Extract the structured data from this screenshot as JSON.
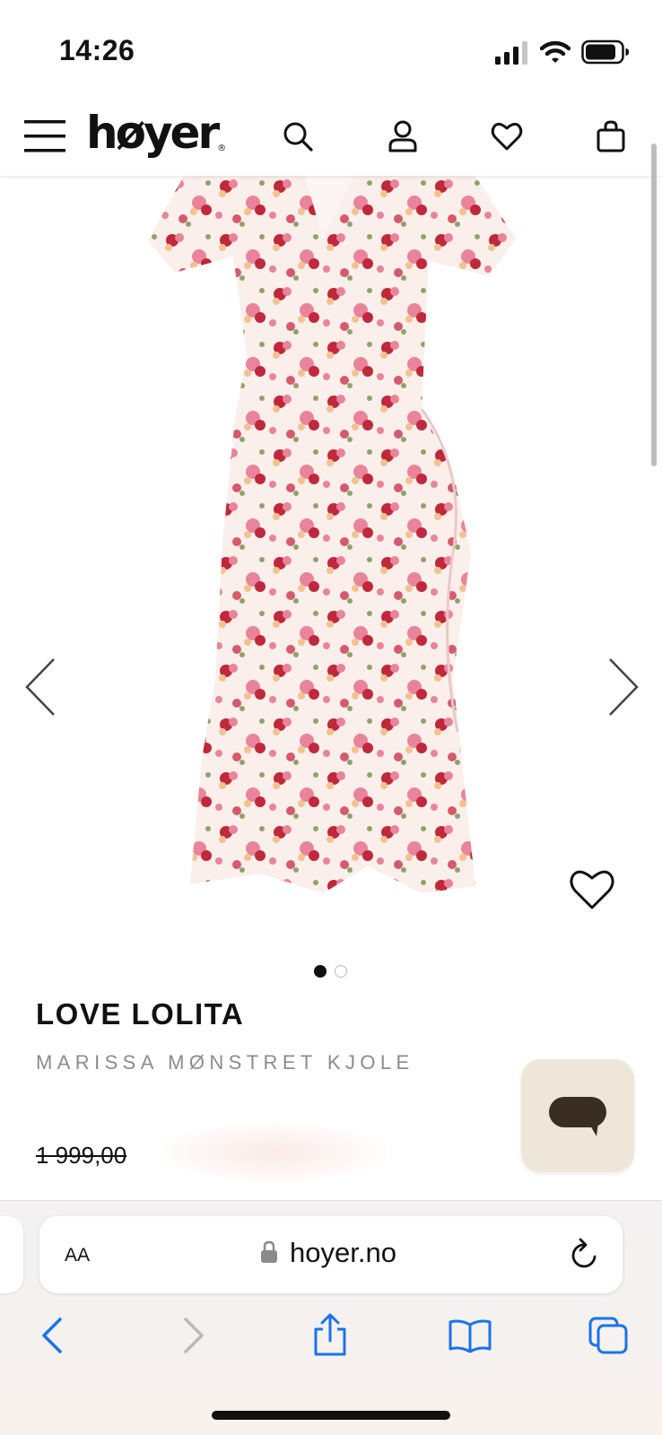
{
  "status_bar": {
    "time": "14:26",
    "icons": [
      "cellular-signal-icon",
      "wifi-icon",
      "battery-icon"
    ]
  },
  "header": {
    "logo": "høyer",
    "logo_mark": "®",
    "icons": [
      "menu-icon",
      "search-icon",
      "user-icon",
      "heart-icon",
      "shopping-bag-icon"
    ]
  },
  "product": {
    "brand": "LOVE LOLITA",
    "name": "MARISSA MØNSTRET KJOLE",
    "price_original": "1 999,00",
    "image_count": 2,
    "active_image": 1,
    "colors": {
      "dress_base": "#fbefec",
      "flower_red": "#c0283b",
      "flower_pink": "#e9849a",
      "flower_peach": "#f2c38f"
    }
  },
  "chat": {
    "background": "#efe6da",
    "icon": "chat-bubble-icon"
  },
  "browser": {
    "text_size_label": "AA",
    "url": "hoyer.no",
    "toolbar_icons": [
      "back-icon",
      "forward-icon",
      "share-icon",
      "bookmarks-icon",
      "tabs-icon"
    ],
    "accent": "#1a73e8"
  }
}
